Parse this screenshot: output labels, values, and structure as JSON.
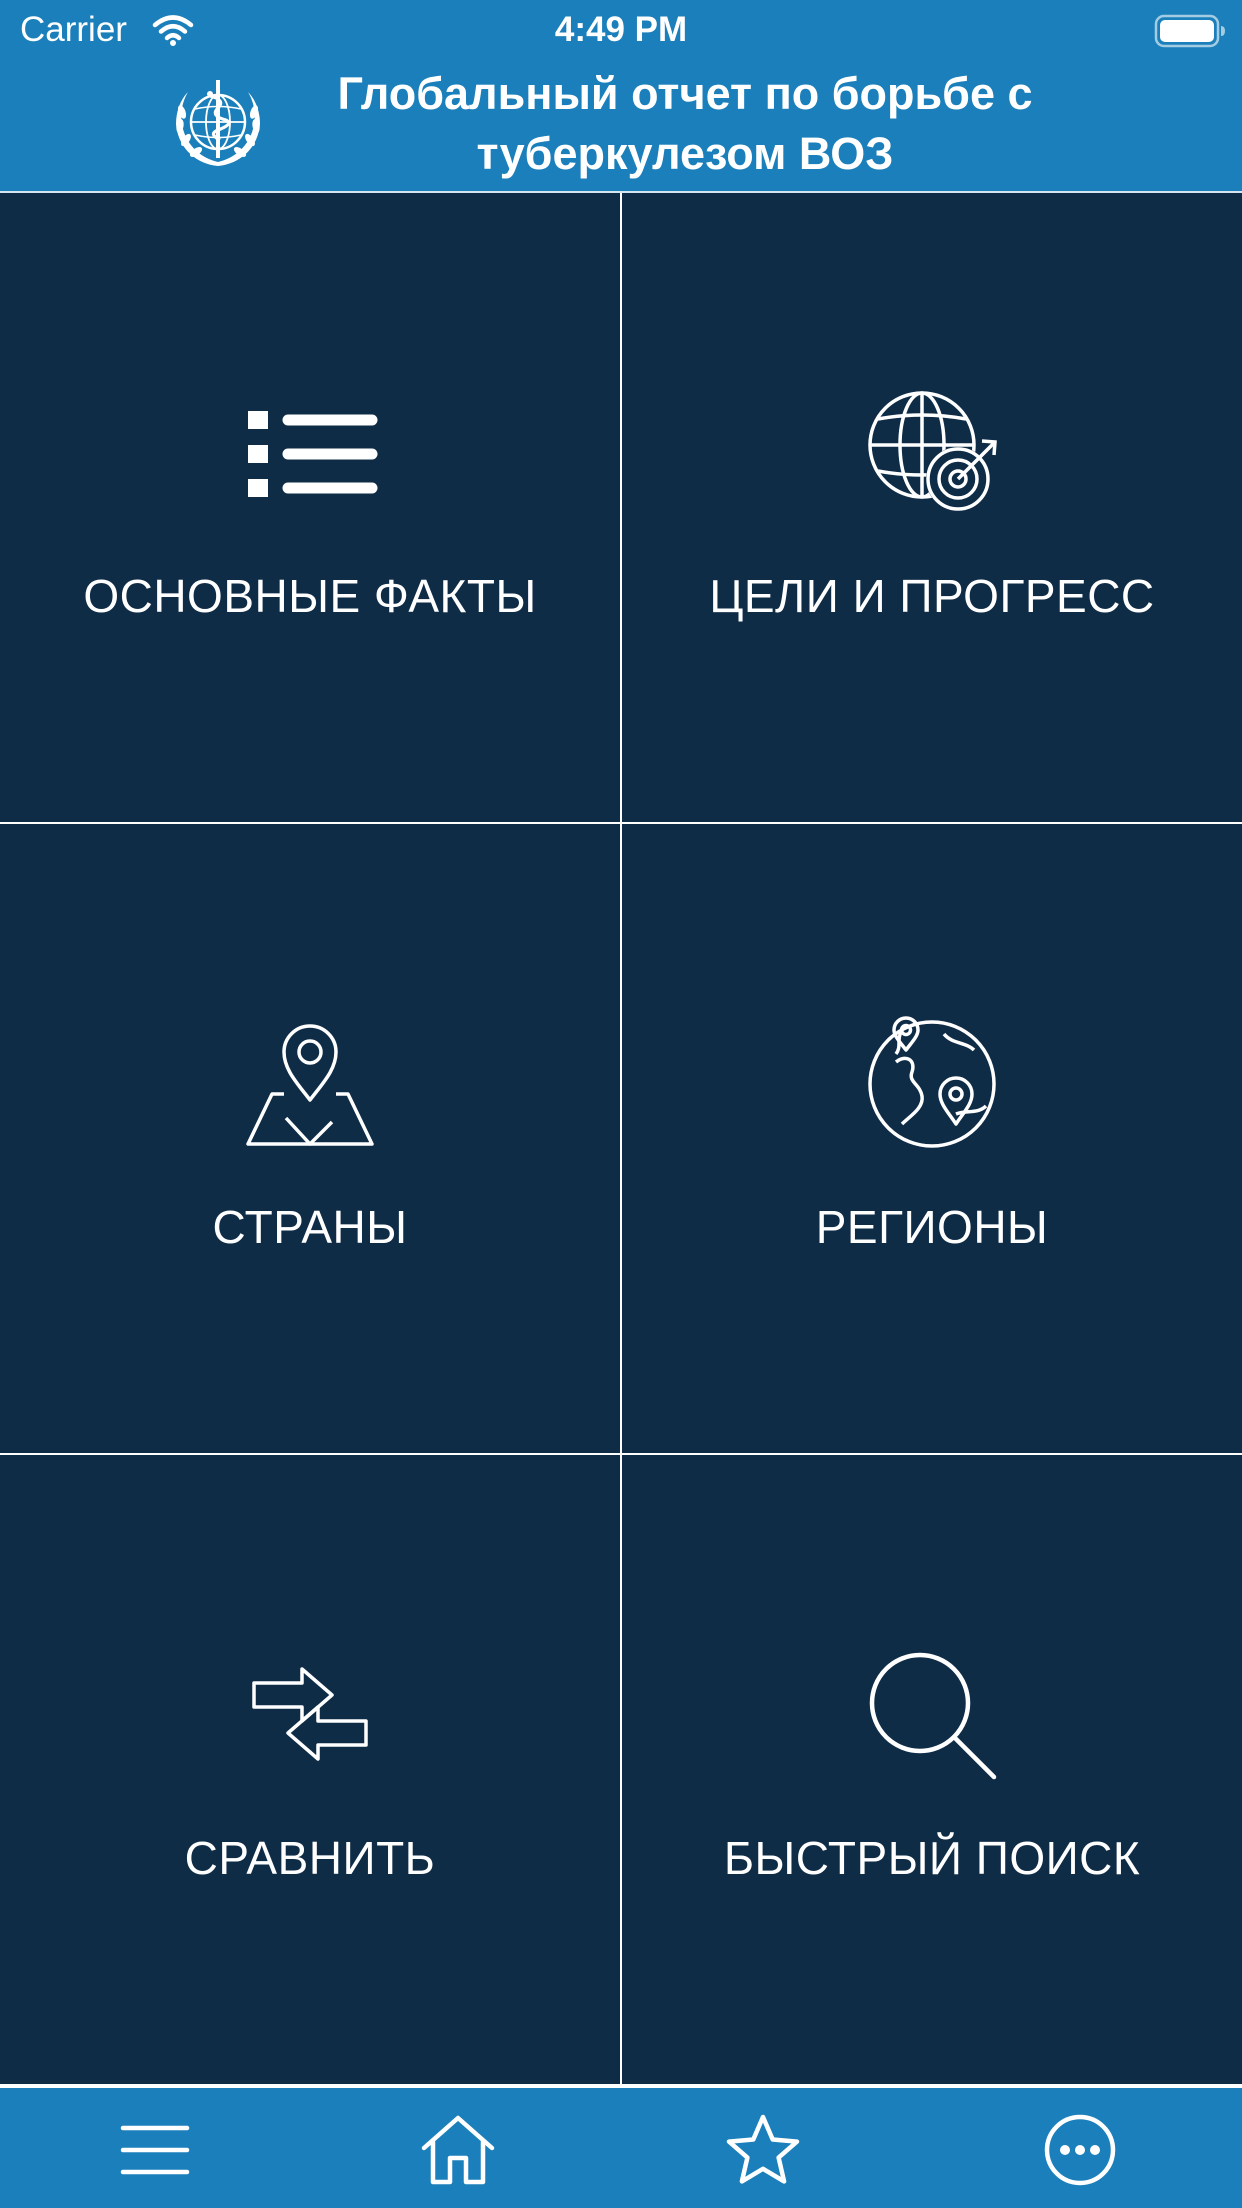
{
  "status_bar": {
    "carrier": "Carrier",
    "time": "4:49 PM",
    "wifi_icon": "wifi-icon",
    "battery_icon": "battery-icon"
  },
  "header": {
    "title": "Глобальный отчет по борьбе с туберкулезом ВОЗ",
    "logo_icon": "who-emblem-icon"
  },
  "grid": {
    "tiles": [
      {
        "label": "ОСНОВНЫЕ ФАКТЫ",
        "icon": "list-icon"
      },
      {
        "label": "ЦЕЛИ И ПРОГРЕСС",
        "icon": "globe-target-icon"
      },
      {
        "label": "СТРАНЫ",
        "icon": "map-pin-icon"
      },
      {
        "label": "РЕГИОНЫ",
        "icon": "globe-pins-icon"
      },
      {
        "label": "СРАВНИТЬ",
        "icon": "compare-arrows-icon"
      },
      {
        "label": "БЫСТРЫЙ ПОИСК",
        "icon": "search-icon"
      }
    ]
  },
  "tab_bar": {
    "tabs": [
      {
        "icon": "menu-icon"
      },
      {
        "icon": "home-icon"
      },
      {
        "icon": "star-icon"
      },
      {
        "icon": "more-icon"
      }
    ]
  },
  "colors": {
    "header_blue": "#1a7fba",
    "tile_navy": "#0f2c47",
    "divider": "#ffffff",
    "text": "#ffffff"
  }
}
